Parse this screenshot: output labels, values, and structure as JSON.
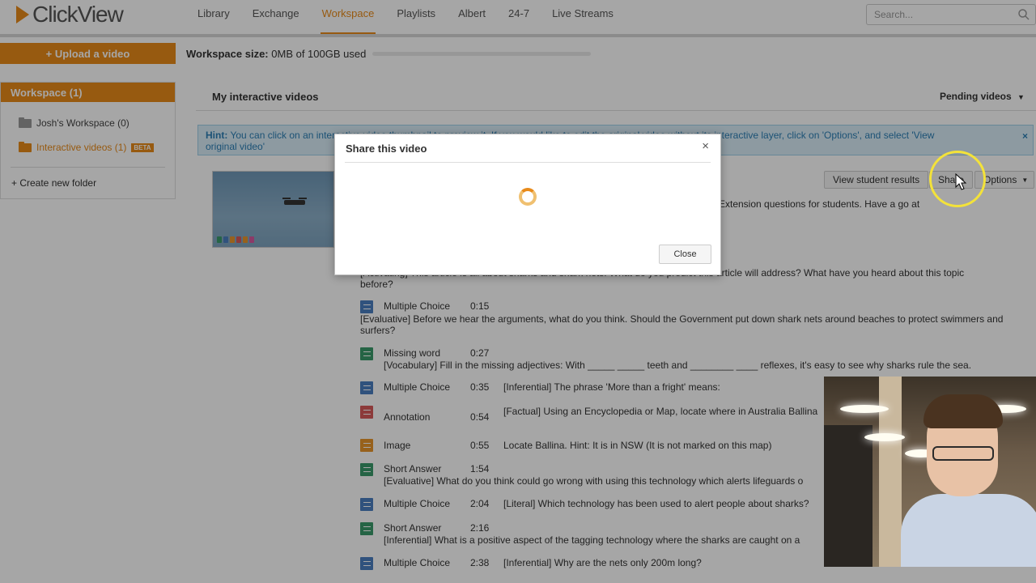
{
  "app": {
    "logo": "ClickView"
  },
  "nav": {
    "items": [
      "Library",
      "Exchange",
      "Workspace",
      "Playlists",
      "Albert",
      "24-7",
      "Live Streams"
    ],
    "active_index": 2,
    "search_placeholder": "Search...",
    "accent_color": "#e88a1a"
  },
  "toolbar": {
    "upload_label": "+ Upload a video",
    "workspace_size_label": "Workspace size:",
    "workspace_size_value": "0MB of 100GB used"
  },
  "sidebar": {
    "header": "Workspace (1)",
    "items": [
      {
        "label": "Josh's Workspace (0)",
        "active": false
      },
      {
        "label": "Interactive videos  (1)",
        "active": true,
        "badge": "BETA"
      }
    ],
    "new_folder": "+ Create new folder"
  },
  "main": {
    "title": "My interactive videos",
    "pending": "Pending videos",
    "hint_bold": "Hint:",
    "hint_text_1": "You can click on an interactive video thumbnail to preview it. If you would like to edit the original video without its interactive layer, click on 'Options', and select 'View",
    "hint_text_2": "original video'",
    "hint_close": "×",
    "video_buttons": {
      "results": "View student results",
      "share": "Share",
      "options": "Options"
    },
    "description_tail": "Extension questions for students. Have a go at",
    "questions": [
      {
        "pre_text": "[Activating] This article is all about sharks and shark nets. What do you predict this article will address? What have you heard about this topic",
        "pre_text_2": "before?"
      },
      {
        "type": "Multiple Choice",
        "time": "0:15",
        "icon": "blue",
        "text": "",
        "sub": "[Evaluative] Before we hear the arguments, what do you think. Should the Government put down shark nets around beaches to protect swimmers and",
        "sub2": "surfers?"
      },
      {
        "type": "Missing word",
        "time": "0:27",
        "icon": "green",
        "text": "",
        "sub": "[Vocabulary] Fill in the missing adjectives: With _____ _____ teeth and ________ ____ reflexes, it's easy to see why sharks rule the sea."
      },
      {
        "type": "Multiple Choice",
        "time": "0:35",
        "icon": "blue",
        "text": "[Inferential] The phrase 'More than a fright' means:"
      },
      {
        "type": "Annotation",
        "time": "0:54",
        "icon": "red",
        "text": "[Factual] Using an Encyclopedia or Map, locate where in Australia Ballina"
      },
      {
        "type": "Image",
        "time": "0:55",
        "icon": "orange",
        "text": "Locate Ballina. Hint: It is in NSW (It is not marked on this map)"
      },
      {
        "type": "Short Answer",
        "time": "1:54",
        "icon": "green",
        "text": "",
        "sub": "[Evaluative] What do you think could go wrong with using this technology which alerts lifeguards o"
      },
      {
        "type": "Multiple Choice",
        "time": "2:04",
        "icon": "blue",
        "text": "[Literal] Which technology has been used to alert people about sharks?"
      },
      {
        "type": "Short Answer",
        "time": "2:16",
        "icon": "green",
        "text": "",
        "sub": "[Inferential] What is a positive aspect of the tagging technology where the sharks are caught on a"
      },
      {
        "type": "Multiple Choice",
        "time": "2:38",
        "icon": "blue",
        "text": "[Inferential] Why are the nets only 200m long?"
      }
    ]
  },
  "modal": {
    "title": "Share this video",
    "close_x": "×",
    "close_button": "Close"
  }
}
